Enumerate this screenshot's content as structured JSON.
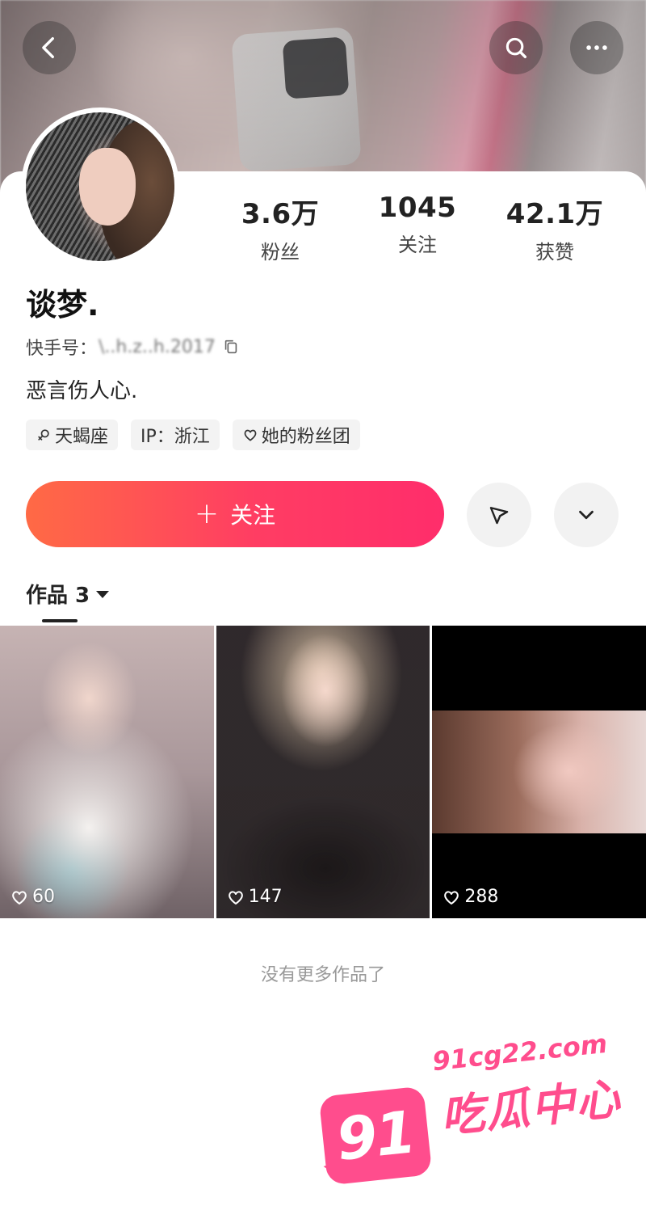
{
  "header": {
    "back_icon": "chevron-left-icon",
    "search_icon": "search-icon",
    "more_icon": "more-horizontal-icon"
  },
  "stats": [
    {
      "value": "3.6万",
      "label": "粉丝"
    },
    {
      "value": "1045",
      "label": "关注"
    },
    {
      "value": "42.1万",
      "label": "获赞"
    }
  ],
  "profile": {
    "name": "谈梦.",
    "id_label": "快手号：",
    "id_value": "\\..h.z..h.2017",
    "bio": "恶言伤人心."
  },
  "tags": [
    {
      "icon": "female-symbol-icon",
      "label": "天蝎座"
    },
    {
      "icon": "",
      "label": "IP：浙江"
    },
    {
      "icon": "heart-outline-icon",
      "label": "她的粉丝团"
    }
  ],
  "actions": {
    "follow_plus": "+",
    "follow_label": "关注",
    "share_icon": "send-icon",
    "expand_icon": "chevron-down-icon"
  },
  "works": {
    "tab_label": "作品 3",
    "items": [
      {
        "likes": "60"
      },
      {
        "likes": "147"
      },
      {
        "likes": "288"
      }
    ],
    "end_text": "没有更多作品了"
  },
  "watermark": {
    "number": "91",
    "site": "91cg22.com",
    "title": "吃瓜中心"
  },
  "colors": {
    "follow_start": "#ff6a45",
    "follow_end": "#ff2d6b",
    "watermark": "#ff4d8d"
  }
}
